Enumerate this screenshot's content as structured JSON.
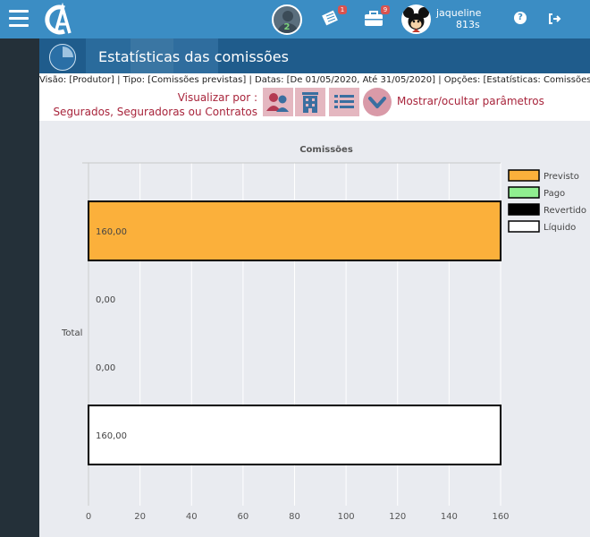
{
  "topbar": {
    "notifications_badge": "1",
    "briefcase_badge": "9",
    "user_avatar_count": "2",
    "user_name": "jaqueline",
    "session_time": "813s",
    "help_label": "?"
  },
  "page": {
    "title": "Estatísticas das comissões",
    "info": "Visão: [Produtor] | Tipo: [Comissões previstas] | Datas: [De 01/05/2020, Até 31/05/2020] | Opções: [Estatísticas: Comissões]",
    "view_by_line1": "Visualizar por :",
    "view_by_line2": "Segurados, Seguradoras ou Contratos",
    "toggle_params": "Mostrar/ocultar parâmetros"
  },
  "colors": {
    "topbar": "#3b8dc4",
    "accent": "#a8243b",
    "previsto": "#fbb03b",
    "pago": "#90ee90",
    "revertido": "#000000",
    "liquido": "#ffffff"
  },
  "chart_data": {
    "type": "bar",
    "orientation": "horizontal",
    "title": "Comissões",
    "categories": [
      "Total"
    ],
    "series": [
      {
        "name": "Previsto",
        "values": [
          160
        ],
        "label": "160,00",
        "color": "#fbb03b"
      },
      {
        "name": "Pago",
        "values": [
          0
        ],
        "label": "0,00",
        "color": "#90ee90"
      },
      {
        "name": "Revertido",
        "values": [
          0
        ],
        "label": "0,00",
        "color": "#000000"
      },
      {
        "name": "Líquido",
        "values": [
          160
        ],
        "label": "160,00",
        "color": "#ffffff"
      }
    ],
    "xlim": [
      0,
      160
    ],
    "xticks": [
      "0",
      "20",
      "40",
      "60",
      "80",
      "100",
      "120",
      "140",
      "160"
    ],
    "xtick_values": [
      0,
      20,
      40,
      60,
      80,
      100,
      120,
      140,
      160
    ],
    "grid": true,
    "legend": "right"
  }
}
